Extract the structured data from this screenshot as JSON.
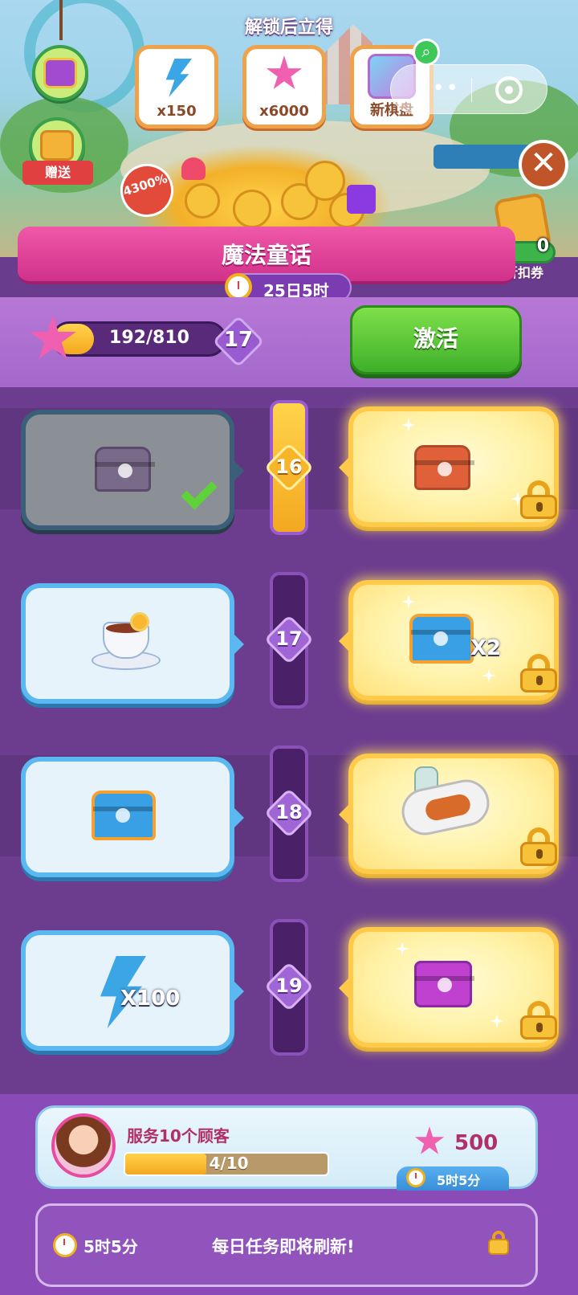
{
  "header": {
    "unlock_title": "解锁后立得",
    "unlock_rewards": [
      {
        "icon": "energy-bolt-icon",
        "label": "x150"
      },
      {
        "icon": "pink-star-icon",
        "label": "x6000"
      },
      {
        "icon": "new-board-icon",
        "label": "新棋盘"
      }
    ],
    "gift_label": "赠送",
    "discount_badge": "4300%",
    "coupon": {
      "count": "0",
      "label": "折扣券"
    }
  },
  "event": {
    "title": "魔法童话",
    "timer": "25日5时"
  },
  "progress": {
    "text": "192/810",
    "current": 192,
    "target": 810,
    "level": "17",
    "activate_label": "激活"
  },
  "rows": [
    {
      "level": "16",
      "free_item": "purple-chest",
      "free_claimed": true,
      "paid_item": "red-chest",
      "paid_mult": ""
    },
    {
      "level": "17",
      "free_item": "lemon-tea",
      "free_claimed": false,
      "paid_item": "blue-chest",
      "paid_mult": "X2"
    },
    {
      "level": "18",
      "free_item": "blue-chest",
      "free_claimed": false,
      "paid_item": "food-plate",
      "paid_mult": ""
    },
    {
      "level": "19",
      "free_item": "energy-bolt",
      "free_claimed": false,
      "free_mult": "X100",
      "paid_item": "purple-box",
      "paid_mult": ""
    }
  ],
  "task": {
    "title": "服务10个顾客",
    "progress_text": "4/10",
    "current": 4,
    "target": 10,
    "reward_value": "500",
    "timer": "5时5分"
  },
  "refresh": {
    "time": "5时5分",
    "message": "每日任务即将刷新!"
  },
  "colors": {
    "purple_bg": "#6a3c8e",
    "ribbon_pink": "#e0449a",
    "activate_green": "#4cc033",
    "gold": "#ffc94a",
    "sky_blue": "#5cb8f0"
  }
}
